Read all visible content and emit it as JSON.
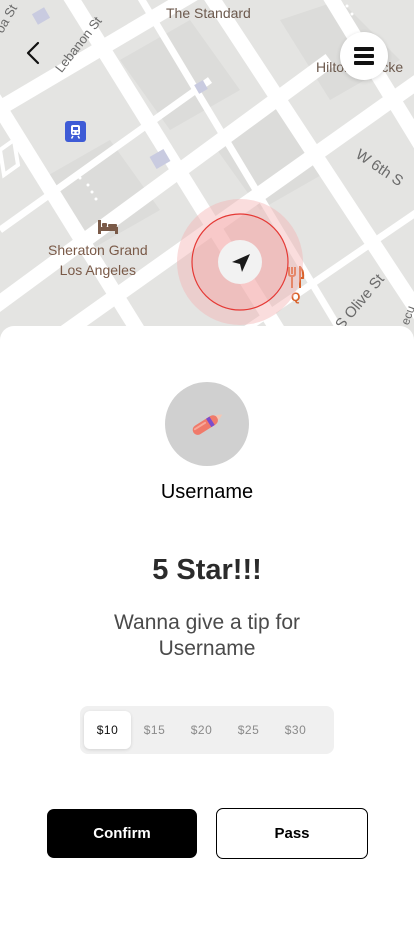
{
  "map": {
    "streets": [
      "oa St",
      "Lebanon St",
      "The Standard",
      "Hilton Checke",
      "W 6th S",
      "S Olive St",
      "ecu"
    ],
    "poi_hotel": "Sheraton Grand\nLos Angeles",
    "poi_restaurant_letter": "Q",
    "icons": {
      "back": "back-arrow-icon",
      "menu": "hamburger-menu-icon",
      "transit": "transit-icon",
      "hotel": "bed-icon",
      "restaurant": "fork-knife-icon",
      "location": "navigation-arrow-icon"
    },
    "colors": {
      "transit": "#3e5bd6",
      "hotel": "#7a5a48",
      "restaurant": "#d9612a",
      "locator": "#e53935"
    }
  },
  "sheet": {
    "username": "Username",
    "rating_title": "5 Star!!!",
    "tip_message": "Wanna give a tip for Username",
    "tip_options": [
      "$10",
      "$15",
      "$20",
      "$25",
      "$30"
    ],
    "selected_tip": "$10",
    "confirm_label": "Confirm",
    "pass_label": "Pass"
  }
}
